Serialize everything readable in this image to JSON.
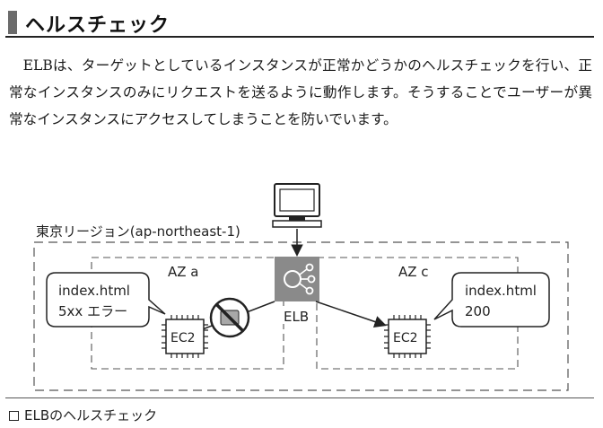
{
  "heading": {
    "title": "ヘルスチェック"
  },
  "body_text": "ELBは、ターゲットとしているインスタンスが正常かどうかのヘルスチェックを行い、正常なインスタンスのみにリクエストを送るように動作します。そうすることでユーザーが異常なインスタンスにアクセスしてしまうことを防いでいます。",
  "diagram": {
    "region_label": "東京リージョン(ap-northeast-1)",
    "az_a_label": "AZ a",
    "az_c_label": "AZ c",
    "elb_label": "ELB",
    "ec2_left_label": "EC2",
    "ec2_right_label": "EC2",
    "callout_left": {
      "line1": "index.html",
      "line2": "5xx エラー"
    },
    "callout_right": {
      "line1": "index.html",
      "line2": "200"
    }
  },
  "caption": "ELBのヘルスチェック"
}
